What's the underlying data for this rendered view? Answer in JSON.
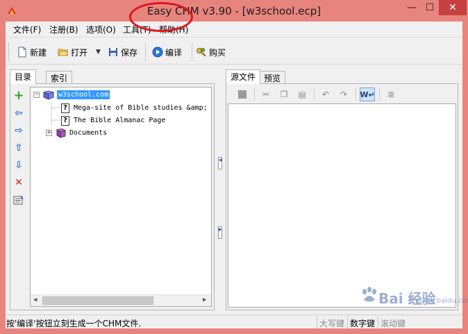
{
  "window": {
    "title": "Easy CHM v3.90 - [w3school.ecp]",
    "controls": {
      "minimize": "—",
      "maximize": "☐",
      "close": "✕"
    }
  },
  "menu": [
    {
      "label": "文件(F)"
    },
    {
      "label": "注册(B)"
    },
    {
      "label": "选项(O)"
    },
    {
      "label": "工具(T)"
    },
    {
      "label": "帮助(H)"
    }
  ],
  "toolbar": {
    "new_label": "新建",
    "open_label": "打开",
    "save_label": "保存",
    "compile_label": "编译",
    "buy_label": "购买"
  },
  "left_pane": {
    "tabs": [
      {
        "label": "目录"
      },
      {
        "label": "索引"
      }
    ],
    "tree": {
      "root": {
        "label": "w3school.com",
        "expander": "−"
      },
      "children": [
        {
          "label": "Mega-site of Bible studies &amp; :"
        },
        {
          "label": "The Bible Almanac Page"
        }
      ],
      "folder": {
        "label": "Documents",
        "expander": "+"
      }
    }
  },
  "right_pane": {
    "tabs": [
      {
        "label": "源文件"
      },
      {
        "label": "预览"
      }
    ]
  },
  "status": {
    "message": "按'编译'按钮立刻生成一个CHM文件.",
    "caps": "大写键",
    "num": "数字键",
    "scroll": "滚动键"
  },
  "watermark": {
    "text": "Bai  经验",
    "sub": "jingyan.baidu.com"
  },
  "colors": {
    "titlebar": "#e8847e",
    "close_button": "#c74040",
    "annotation_circle": "#e0141b",
    "tree_selection": "#3399ff"
  }
}
